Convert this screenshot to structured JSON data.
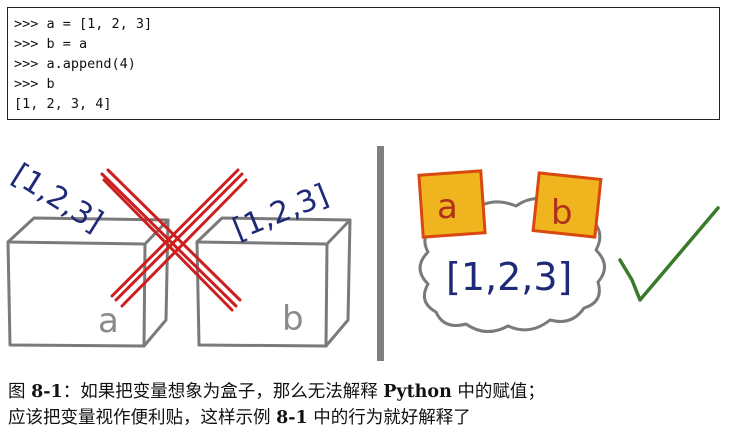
{
  "code": {
    "lines": [
      ">>> a = [1, 2, 3]",
      ">>> b = a",
      ">>> a.append(4)",
      ">>> b",
      "[1, 2, 3, 4]"
    ]
  },
  "figure": {
    "left": {
      "box_a_label": "a",
      "box_b_label": "b",
      "list_a_label": "[1,2,3]",
      "list_b_label": "[1,2,3]"
    },
    "right": {
      "sticker_a_label": "a",
      "sticker_b_label": "b",
      "object_label": "[1,2,3]"
    },
    "colors": {
      "cross": "#cc1f1f",
      "handwriting": "#1e2a78",
      "box_stroke": "#7a7a7a",
      "sticker_fill": "#f0b41e",
      "sticker_stroke": "#d9480f",
      "check": "#3a7a2a",
      "divider": "#808080"
    }
  },
  "caption": {
    "fig_prefix": "图 ",
    "fig_number": "8-1",
    "line1_text": "：如果把变量想象为盒子，那么无法解释 ",
    "python": "Python",
    "line1_end": " 中的赋值；",
    "line2_start": "应该把变量视作便利贴，这样示例 ",
    "example_number": "8-1",
    "line2_end": " 中的行为就好解释了"
  }
}
